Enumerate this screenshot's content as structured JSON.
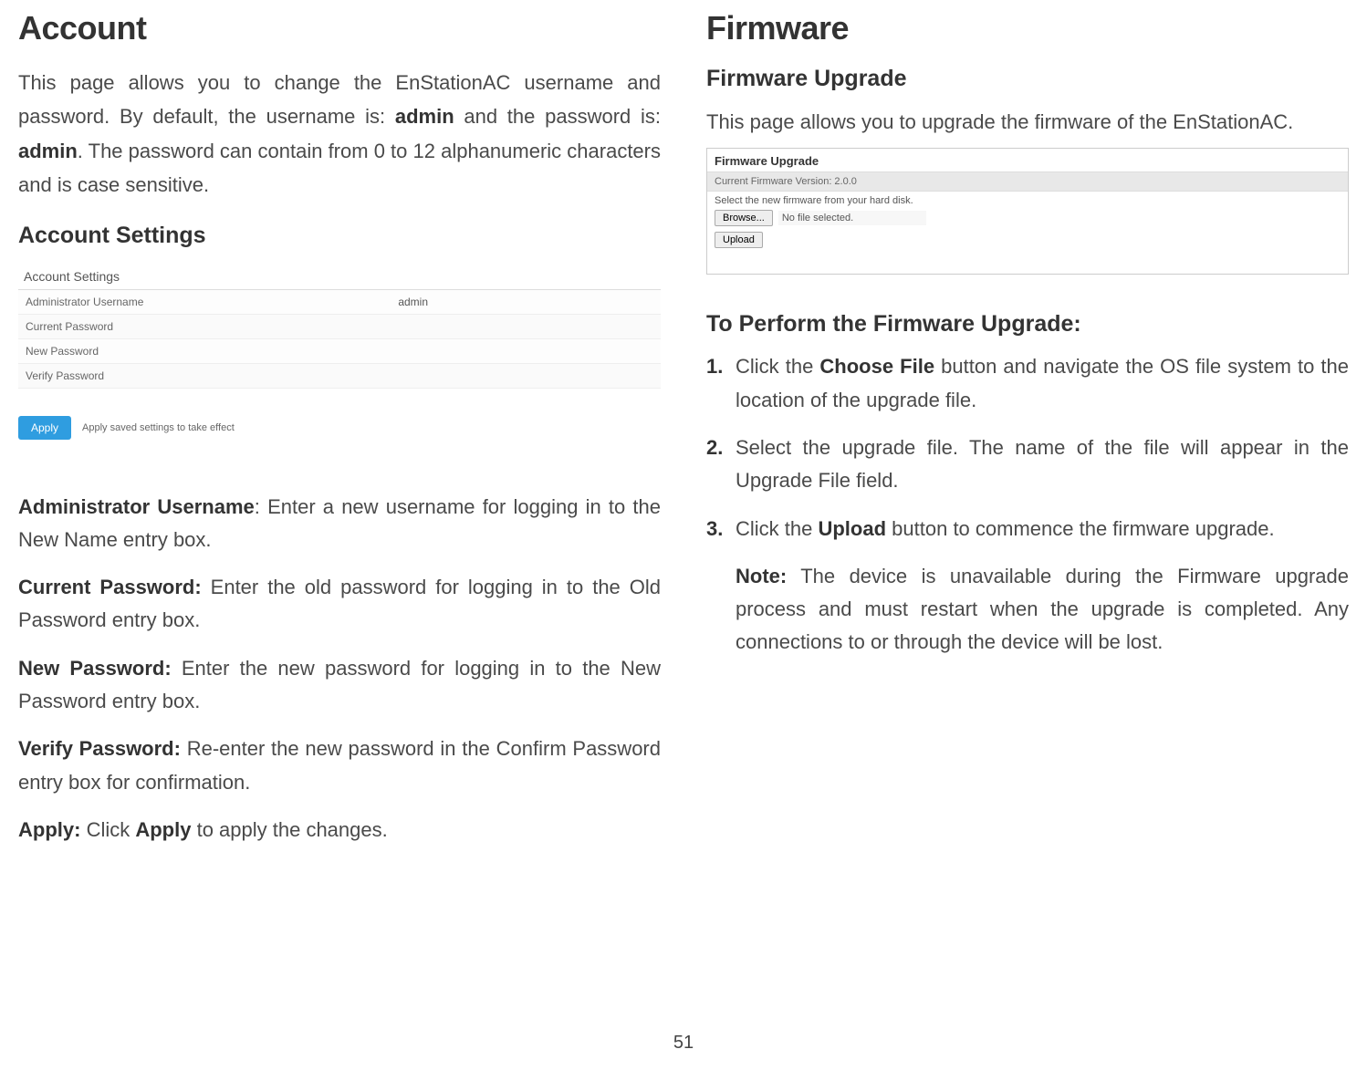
{
  "page_number": "51",
  "left": {
    "heading": "Account",
    "intro_parts": {
      "p1": "This page allows you to change the EnStationAC username and password. By default, the username is: ",
      "b1": "admin",
      "p2": " and the password is: ",
      "b2": "admin",
      "p3": ". The password can contain from 0 to 12 alphanumeric characters and is case sensitive."
    },
    "subhead": "Account Settings",
    "acct_box": {
      "title": "Account Settings",
      "rows": [
        {
          "label": "Administrator Username",
          "value": "admin"
        },
        {
          "label": "Current Password",
          "value": ""
        },
        {
          "label": "New Password",
          "value": ""
        },
        {
          "label": "Verify Password",
          "value": ""
        }
      ],
      "apply_label": "Apply",
      "apply_note": "Apply saved settings to take effect"
    },
    "fields": [
      {
        "label": "Administrator Username",
        "text": ": Enter a new username for logging in to the New Name entry box."
      },
      {
        "label": "Current Password:",
        "text": " Enter the old password for logging in to the Old Password entry box."
      },
      {
        "label": "New Password:",
        "text": " Enter the new password for logging in to the New Password entry box."
      },
      {
        "label": "Verify Password:",
        "text": " Re-enter the new password in the Confirm Password entry box for confirmation."
      },
      {
        "label": "Apply:",
        "text_before": " Click ",
        "bold_mid": "Apply",
        "text_after": " to apply the changes."
      }
    ]
  },
  "right": {
    "heading": "Firmware",
    "subhead1": "Firmware Upgrade",
    "intro": "This page allows you to upgrade the firmware of the EnStationAC.",
    "fw_box": {
      "title": "Firmware Upgrade",
      "version_line": "Current Firmware Version: 2.0.0",
      "select_line": "Select the new firmware from your hard disk.",
      "browse_label": "Browse...",
      "nofile": "No file selected.",
      "upload_label": "Upload"
    },
    "subhead2": "To Perform the Firmware Upgrade:",
    "steps": {
      "s1": {
        "pre": "Click the ",
        "bold": "Choose File",
        "post": " button and navigate the OS file system to the location of the upgrade file."
      },
      "s2": {
        "text": "Select the upgrade file. The name of the file will appear in the Upgrade File field."
      },
      "s3": {
        "pre": "Click the ",
        "bold": "Upload",
        "post": " button to commence the firmware upgrade."
      }
    },
    "note": {
      "label": "Note:",
      "text": " The device is unavailable during the Firmware upgrade process and must restart when the upgrade is completed. Any connections to or through the device will be lost."
    }
  }
}
